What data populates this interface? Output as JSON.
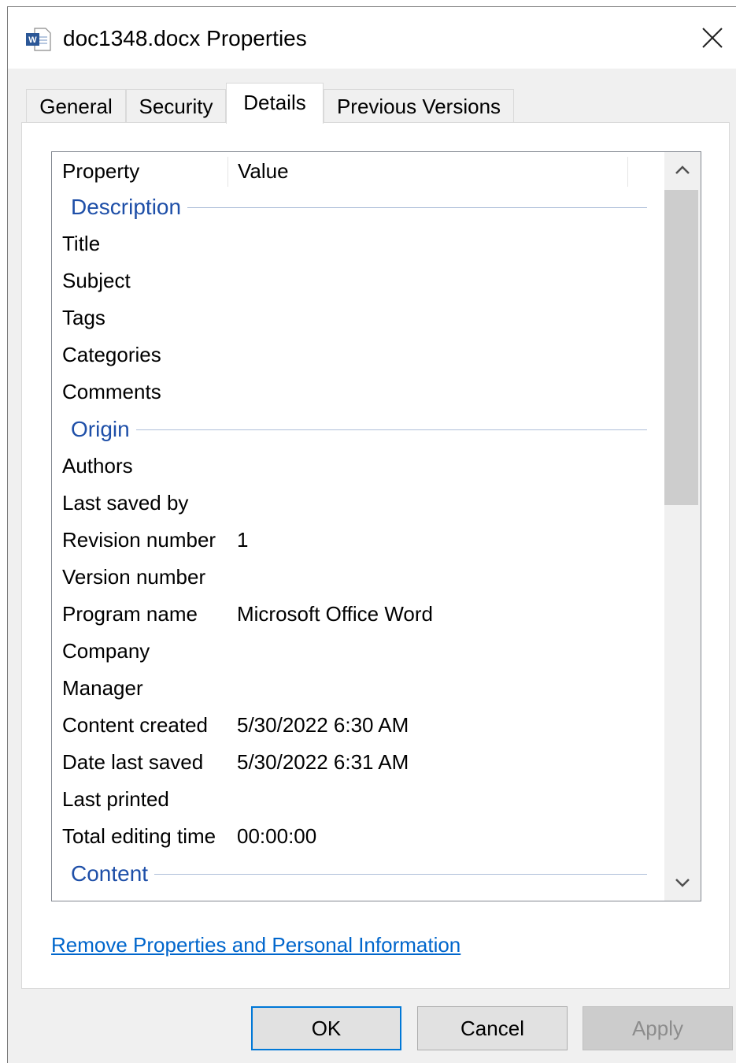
{
  "window": {
    "title": "doc1348.docx Properties",
    "icon": "word-document-icon",
    "close_icon": "close-icon"
  },
  "tabs": [
    {
      "label": "General",
      "active": false
    },
    {
      "label": "Security",
      "active": false
    },
    {
      "label": "Details",
      "active": true
    },
    {
      "label": "Previous Versions",
      "active": false
    }
  ],
  "list": {
    "columns": {
      "property": "Property",
      "value": "Value"
    },
    "groups": {
      "description": "Description",
      "origin": "Origin",
      "content": "Content"
    },
    "description_rows": [
      {
        "key": "Title",
        "value": ""
      },
      {
        "key": "Subject",
        "value": ""
      },
      {
        "key": "Tags",
        "value": ""
      },
      {
        "key": "Categories",
        "value": ""
      },
      {
        "key": "Comments",
        "value": ""
      }
    ],
    "origin_rows": [
      {
        "key": "Authors",
        "value": ""
      },
      {
        "key": "Last saved by",
        "value": ""
      },
      {
        "key": "Revision number",
        "value": "1"
      },
      {
        "key": "Version number",
        "value": ""
      },
      {
        "key": "Program name",
        "value": "Microsoft Office Word"
      },
      {
        "key": "Company",
        "value": ""
      },
      {
        "key": "Manager",
        "value": ""
      },
      {
        "key": "Content created",
        "value": "5/30/2022 6:30 AM"
      },
      {
        "key": "Date last saved",
        "value": "5/30/2022 6:31 AM"
      },
      {
        "key": "Last printed",
        "value": ""
      },
      {
        "key": "Total editing time",
        "value": "00:00:00"
      }
    ]
  },
  "link": {
    "label": "Remove Properties and Personal Information"
  },
  "buttons": {
    "ok": "OK",
    "cancel": "Cancel",
    "apply": "Apply"
  },
  "colors": {
    "group_header": "#1e4fa8",
    "link": "#0066cc",
    "default_button_border": "#0078d7"
  }
}
